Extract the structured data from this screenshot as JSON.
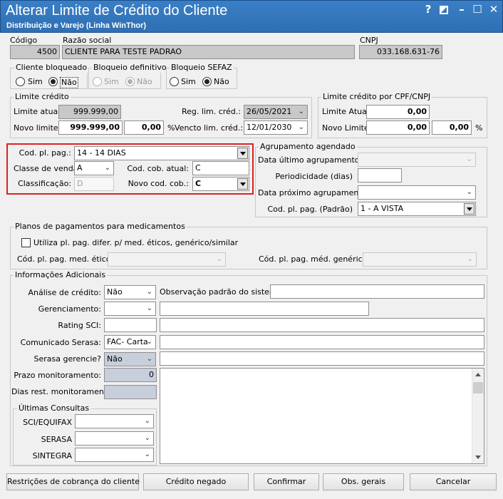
{
  "window": {
    "title": "Alterar Limite de Crédito do Cliente",
    "subtitle": "Distribuição e Varejo (Linha WinThor)",
    "help": "?",
    "minimize": "–",
    "maximize": "☐",
    "close": "✕"
  },
  "header": {
    "codigo_label": "Código",
    "codigo_value": "4500",
    "razao_label": "Razão social",
    "razao_value": "CLIENTE PARA TESTE PADRAO",
    "cnpj_label": "CNPJ",
    "cnpj_value": "033.168.631-76"
  },
  "cliente_bloqueado": {
    "title": "Cliente bloqueado",
    "sim": "Sim",
    "nao": "Não",
    "selected": "Não"
  },
  "bloqueio_definitivo": {
    "title": "Bloqueio definitivo",
    "sim": "Sim",
    "nao": "Não",
    "selected": "Não"
  },
  "bloqueio_sefaz": {
    "title": "Bloqueio SEFAZ",
    "sim": "Sim",
    "nao": "Não",
    "selected": "Não"
  },
  "limite_credito": {
    "title": "Limite crédito",
    "limite_atual_label": "Limite atual:",
    "limite_atual_value": "999.999,00",
    "novo_limite_label": "Novo limite:",
    "novo_limite_value": "999.999,00",
    "percent_value": "0,00",
    "percent_sign": "%",
    "reg_label": "Reg. lim. créd.:",
    "reg_value": "26/05/2021",
    "vencto_label": "Vencto lim. créd.:",
    "vencto_value": "12/01/2030"
  },
  "limite_cpf": {
    "title": "Limite crédito por CPF/CNPJ",
    "limite_atual_label": "Limite Atual:",
    "limite_atual_value": "0,00",
    "novo_limite_label": "Novo Limite:",
    "novo_limite_value": "0,00",
    "percent_value": "0,00",
    "percent_sign": "%"
  },
  "pagamento": {
    "cod_pl_pag_label": "Cod. pl. pag.:",
    "cod_pl_pag_value": "14 - 14 DIAS",
    "classe_label": "Classe de venda:",
    "classe_value": "A",
    "cod_cob_atual_label": "Cod. cob. atual:",
    "cod_cob_atual_value": "C",
    "classificacao_label": "Classificação:",
    "classificacao_value": "D",
    "novo_cod_cob_label": "Novo cod. cob.:",
    "novo_cod_cob_value": "C"
  },
  "agrupamento": {
    "title": "Agrupamento agendado",
    "data_ultimo_label": "Data último agrupamento",
    "periodicidade_label": "Periodicidade (dias)",
    "data_proximo_label": "Data próximo agrupamento",
    "cod_pl_pag_padrao_label": "Cod. pl. pag. (Padrão)",
    "cod_pl_pag_padrao_value": "1 - A VISTA"
  },
  "medicamentos": {
    "title": "Planos de pagamentos para medicamentos",
    "checkbox_label": "Utiliza pl. pag. difer. p/ med. éticos, genérico/similar",
    "etico_label": "Cód. pl. pag. med. ético:",
    "generico_label": "Cód. pl. pag. méd. genérico:"
  },
  "info": {
    "title": "Informações Adicionais",
    "analise_label": "Análise de crédito:",
    "analise_value": "Não",
    "observacao_label": "Observação padrão do sistema:",
    "gerenciamento_label": "Gerenciamento:",
    "rating_label": "Rating SCI:",
    "comunicado_label": "Comunicado Serasa:",
    "comunicado_value": "FAC- Carta",
    "serasa_gerencie_label": "Serasa gerencie?",
    "serasa_gerencie_value": "Não",
    "prazo_label": "Prazo monitoramento:",
    "prazo_value": "0",
    "dias_label": "Dias rest. monitoramento:"
  },
  "ultimas_consultas": {
    "title": "Últimas Consultas",
    "sci_label": "SCI/EQUIFAX",
    "serasa_label": "SERASA",
    "sintegra_label": "SINTEGRA"
  },
  "buttons": {
    "restricoes": "Restrições de cobrança do cliente",
    "credito_negado": "Crédito negado",
    "confirmar": "Confirmar",
    "obs_gerais": "Obs. gerais",
    "cancelar": "Cancelar"
  }
}
